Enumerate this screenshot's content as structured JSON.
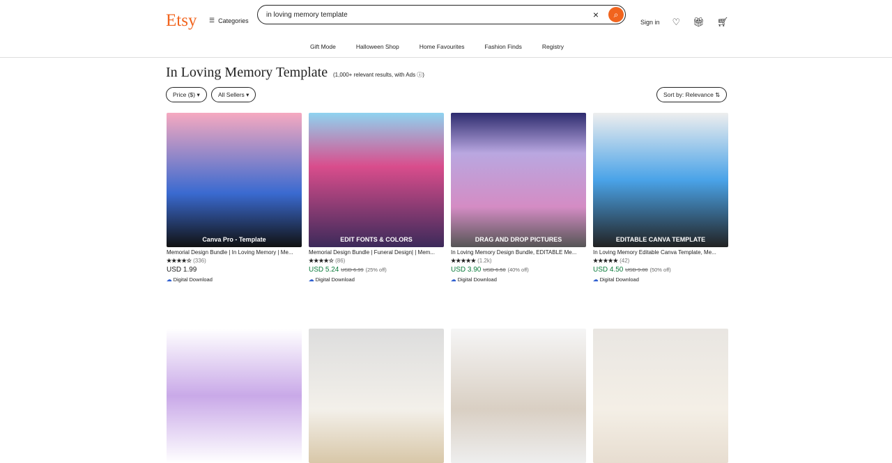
{
  "header": {
    "logo": "Etsy",
    "categories": "Categories",
    "search_value": "in loving memory template",
    "sign_in": "Sign in"
  },
  "nav": [
    "Gift Mode",
    "Halloween Shop",
    "Home Favourites",
    "Fashion Finds",
    "Registry"
  ],
  "title": "In Loving Memory Template",
  "count": "(1,000+ relevant results, with Ads ⓘ)",
  "filters": {
    "price": "Price ($) ▾",
    "sellers": "All Sellers ▾",
    "sort": "Sort by: Relevance ⇅"
  },
  "colors": {
    "brand": "#f1641e",
    "sale": "#0a7a3a"
  },
  "products": [
    {
      "title": "Memorial Design Bundle | In Loving Memory | Me...",
      "stars": "★★★★☆",
      "reviews": "(336)",
      "price": "USD 1.99",
      "original": "",
      "discount": "",
      "delivery": "Digital Download",
      "img_text": "Canva Pro - Template",
      "bg": "linear-gradient(#f6a9c0,#3a6ad0 60%,#111)"
    },
    {
      "title": "Memorial Design Bundle | Funeral Design| | Mem...",
      "stars": "★★★★☆",
      "reviews": "(86)",
      "price": "USD 5.24",
      "original": "USD 6.99",
      "discount": "(25% off)",
      "delivery": "Digital Download",
      "img_text": "EDIT FONTS & COLORS",
      "bg": "linear-gradient(#8fd3f0,#d94d8c 40%,#3c2a5a)"
    },
    {
      "title": "In Loving Memory Design Bundle, EDITABLE Me...",
      "stars": "★★★★★",
      "reviews": "(1.2k)",
      "price": "USD 3.90",
      "original": "USD 6.50",
      "discount": "(40% off)",
      "delivery": "Digital Download",
      "img_text": "DRAG AND DROP PICTURES",
      "bg": "linear-gradient(#2d2b6e,#b9a7e0 30%,#d48cc4 70%,#555)"
    },
    {
      "title": "In Loving Memory Editable Canva Template, Me...",
      "stars": "★★★★★",
      "reviews": "(42)",
      "price": "USD 4.50",
      "original": "USD 9.00",
      "discount": "(50% off)",
      "delivery": "Digital Download",
      "img_text": "EDITABLE CANVA TEMPLATE",
      "bg": "linear-gradient(#eee,#4aa3e8 50%,#222)"
    },
    {
      "bg": "linear-gradient(#fff,#c9a9e8 50%,#fff)"
    },
    {
      "bg": "linear-gradient(#ddd,#f3f0ea 60%,#d8c7a8)"
    },
    {
      "bg": "linear-gradient(#f5f5f5,#d9cfc3 60%,#eee)"
    },
    {
      "bg": "linear-gradient(#e9e6e2,#f4efe6 60%,#e7ddd0)"
    }
  ]
}
